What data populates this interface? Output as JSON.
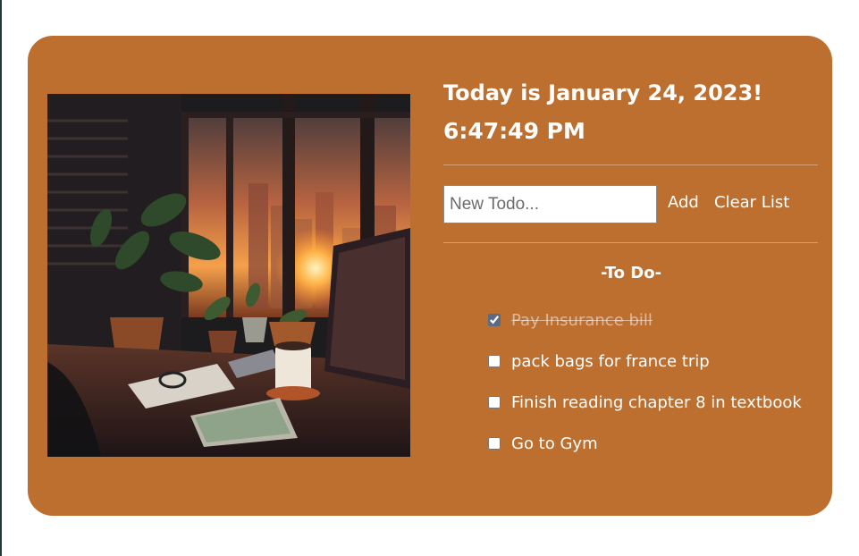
{
  "header": {
    "date_text": "Today is January 24, 2023!",
    "time_text": "6:47:49 PM"
  },
  "form": {
    "input_placeholder": "New Todo...",
    "input_value": "",
    "add_label": "Add",
    "clear_label": "Clear List"
  },
  "list": {
    "heading": "-To Do-",
    "items": [
      {
        "label": "Pay Insurance bill",
        "done": true
      },
      {
        "label": "pack bags for france trip",
        "done": false
      },
      {
        "label": "Finish reading chapter 8 in textbook",
        "done": false
      },
      {
        "label": "Go to Gym",
        "done": false
      }
    ]
  },
  "image": {
    "alt": "illustration of a desk by a window with a sunset city view"
  },
  "colors": {
    "card_background": "#bd6f30",
    "text": "#ffffff",
    "page_background": "#ffffff"
  }
}
